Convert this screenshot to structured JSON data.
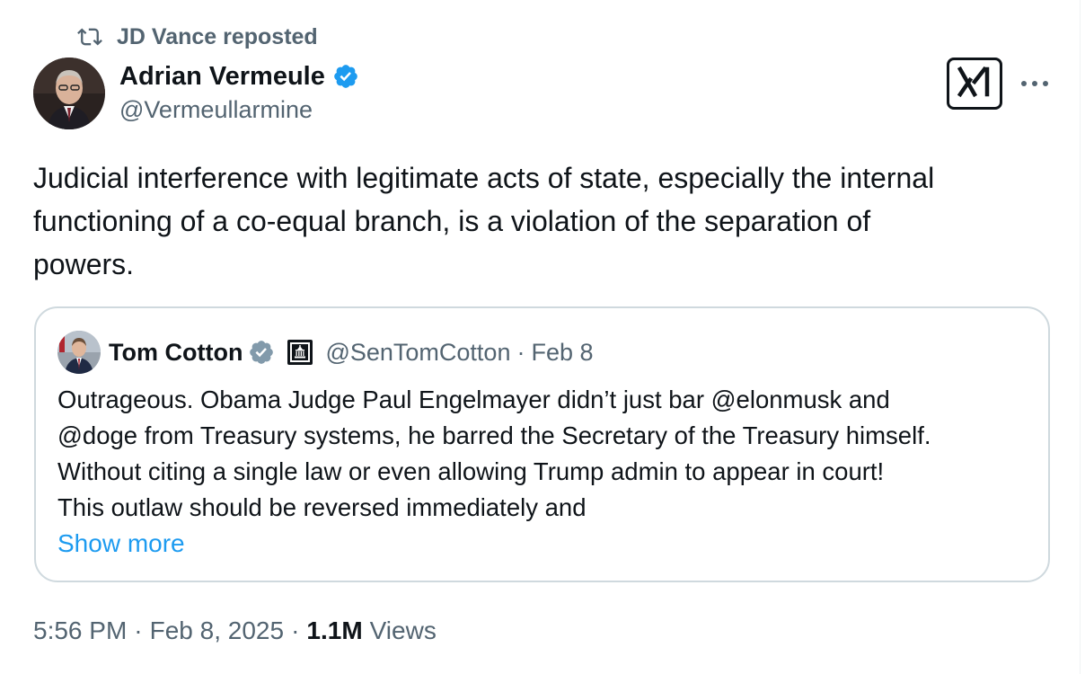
{
  "repost": {
    "icon": "repost-icon",
    "label": "JD Vance reposted"
  },
  "author": {
    "avatar": "avatar",
    "name": "Adrian Vermeule",
    "verified_icon": "verified-badge-icon",
    "handle": "@Vermeullarmine"
  },
  "actions": {
    "grok_icon": "grok-icon",
    "more_icon": "more-icon"
  },
  "tweet": {
    "text_lines": [
      "Judicial interference with legitimate acts of state, especially the internal",
      "functioning of a co-equal branch, is a violation of the separation of",
      "powers."
    ]
  },
  "quote": {
    "name": "Tom Cotton",
    "verified_icon": "verified-grey-icon",
    "affiliation_icon": "government-building-icon",
    "handle": "@SenTomCotton",
    "dot": "·",
    "date": "Feb 8",
    "text_lines": [
      "Outrageous. Obama Judge Paul Engelmayer didn’t just bar @elonmusk and",
      "@doge from Treasury systems, he barred the Secretary of the Treasury himself.",
      "Without citing a single law or even allowing Trump admin to appear in court!",
      "This outlaw should be reversed immediately and"
    ],
    "show_more": "Show more"
  },
  "meta": {
    "time": "5:56 PM",
    "sep1": "·",
    "date": "Feb 8, 2025",
    "sep2": "·",
    "views_count": "1.1M",
    "views_label": "Views"
  },
  "colors": {
    "text_primary": "#0f1419",
    "text_secondary": "#536471",
    "verified_blue": "#1d9bf0",
    "verified_grey": "#829aab",
    "border": "#cfd9de",
    "link": "#1d9bf0"
  }
}
